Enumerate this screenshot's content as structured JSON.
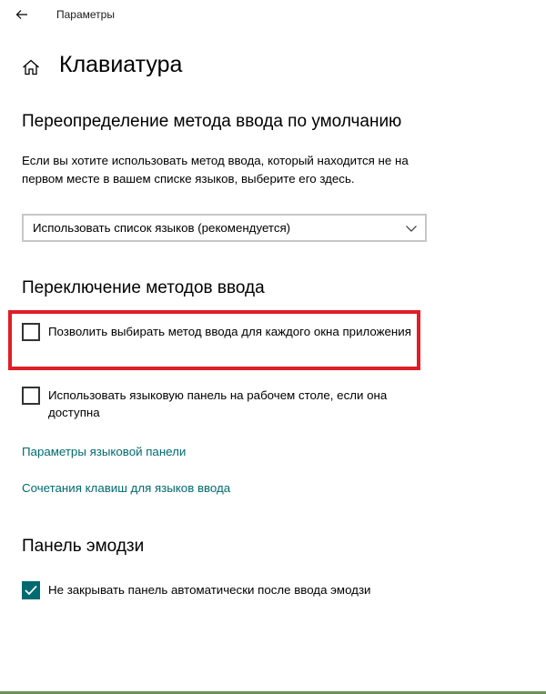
{
  "window": {
    "app_title": "Параметры",
    "icons": {
      "back": "arrow-left-icon",
      "home": "home-icon"
    }
  },
  "page": {
    "title": "Клавиатура"
  },
  "input_method_section": {
    "heading": "Переопределение метода ввода по умолчанию",
    "description": "Если вы хотите использовать метод ввода, который находится не на первом месте в вашем списке языков, выберите его здесь.",
    "dropdown_value": "Использовать список языков (рекомендуется)"
  },
  "switching_section": {
    "heading": "Переключение методов ввода",
    "per_app_checkbox": {
      "label": "Позволить выбирать метод ввода для каждого окна приложения",
      "checked": false
    },
    "language_bar_checkbox": {
      "label": "Использовать языковую панель на рабочем столе, если она доступна",
      "checked": false
    },
    "link_language_bar_options": "Параметры языковой панели",
    "link_input_language_hotkeys": "Сочетания клавиш для языков ввода"
  },
  "emoji_section": {
    "heading": "Панель эмодзи",
    "keep_open_checkbox": {
      "label": "Не закрывать панель автоматически после ввода эмодзи",
      "checked": true
    }
  },
  "colors": {
    "accent": "#006a70",
    "highlight": "#e01e27"
  }
}
